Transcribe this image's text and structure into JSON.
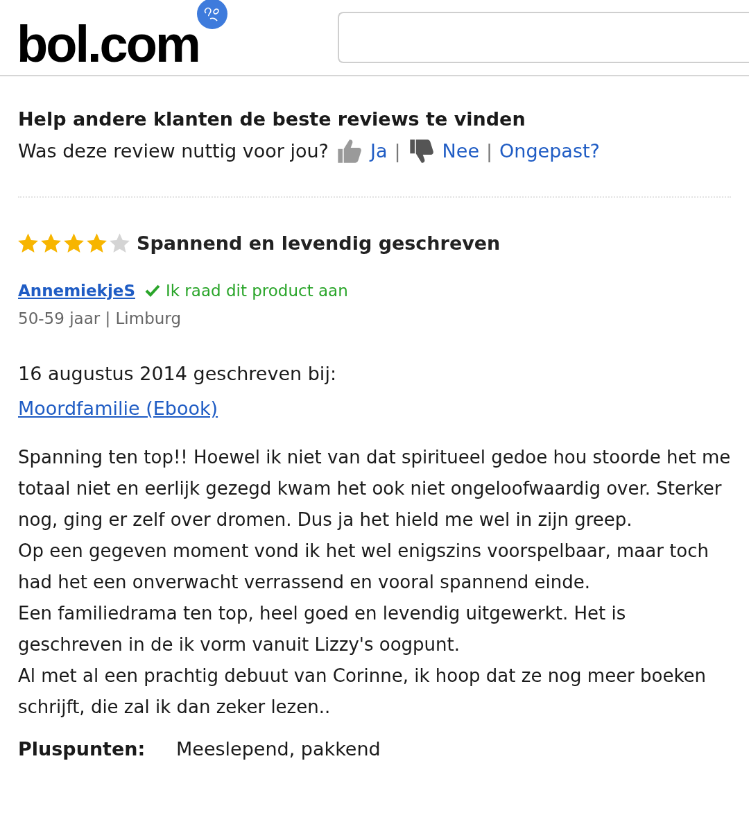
{
  "header": {
    "logo": "bol.com"
  },
  "previous_review": {
    "help_title": "Help andere klanten de beste reviews te vinden",
    "question": "Was deze review nuttig voor jou?",
    "yes": "Ja",
    "separator_1": "|",
    "no": "Nee",
    "separator_2": "|",
    "report": "Ongepast?"
  },
  "review": {
    "stars": 4,
    "title": "Spannend en levendig geschreven",
    "author": "AnnemiekjeS",
    "recommend": "Ik raad dit product aan",
    "meta": "50-59 jaar | Limburg",
    "date": "16 augustus 2014 geschreven bij:",
    "product": "Moordfamilie (Ebook)",
    "paragraphs": [
      "Spanning ten top!! Hoewel ik niet van dat spiritueel gedoe hou stoorde het me totaal niet en eerlijk gezegd kwam het ook niet ongeloofwaardig over. Sterker nog, ging er zelf over dromen. Dus ja het hield me wel in zijn greep.",
      "Op een gegeven moment vond ik het wel enigszins voorspelbaar, maar toch had het een onverwacht verrassend en vooral spannend einde.",
      "Een familiedrama ten top, heel goed en levendig uitgewerkt. Het is geschreven in de ik vorm vanuit Lizzy's oogpunt.",
      "Al met al een prachtig debuut van Corinne, ik hoop dat ze nog meer boeken schrijft, die zal ik dan zeker lezen.."
    ],
    "pros_label": "Pluspunten:",
    "pros": "Meeslepend, pakkend"
  }
}
